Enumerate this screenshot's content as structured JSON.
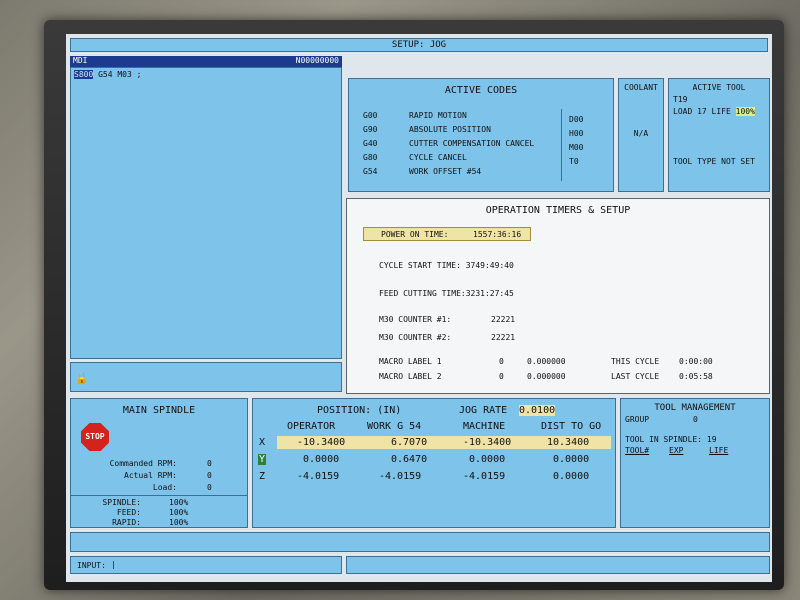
{
  "header": {
    "title": "SETUP: JOG"
  },
  "mdi": {
    "label": "MDI",
    "program_number": "N00000000",
    "cursor_block": "S800",
    "program_rest": " G54 M03 ;"
  },
  "active_codes": {
    "title": "ACTIVE CODES",
    "rows": [
      {
        "code": "G00",
        "desc": "RAPID MOTION"
      },
      {
        "code": "G90",
        "desc": "ABSOLUTE POSITION"
      },
      {
        "code": "G40",
        "desc": "CUTTER COMPENSATION CANCEL"
      },
      {
        "code": "G80",
        "desc": "CYCLE CANCEL"
      },
      {
        "code": "G54",
        "desc": "WORK OFFSET #54"
      }
    ],
    "side": [
      "D00",
      "H00",
      "M00",
      "T0"
    ]
  },
  "coolant": {
    "title": "COOLANT",
    "value": "N/A"
  },
  "active_tool": {
    "title": "ACTIVE TOOL",
    "tool": "T19",
    "load_life_prefix": "LOAD 17 LIFE ",
    "life_value": "100%",
    "tool_type": "TOOL TYPE NOT SET"
  },
  "timers": {
    "title": "OPERATION TIMERS & SETUP",
    "power_on_label": "POWER ON TIME:",
    "power_on_value": "1557:36:16",
    "cycle_start": "CYCLE START TIME: 3749:49:40",
    "feed_cutting": "FEED CUTTING TIME:3231:27:45",
    "m30_1_label": "M30 COUNTER #1:",
    "m30_1_value": "22221",
    "m30_2_label": "M30 COUNTER #2:",
    "m30_2_value": "22221",
    "macro1_label": "MACRO LABEL 1",
    "macro1_num": "0",
    "macro1_val": "0.000000",
    "macro2_label": "MACRO LABEL 2",
    "macro2_num": "0",
    "macro2_val": "0.000000",
    "this_cycle_label": "THIS CYCLE",
    "this_cycle_value": "0:00:00",
    "last_cycle_label": "LAST CYCLE",
    "last_cycle_value": "0:05:58"
  },
  "main_spindle": {
    "title": "MAIN SPINDLE",
    "stop_label": "STOP",
    "commanded_rpm_label": "Commanded RPM:",
    "commanded_rpm": "0",
    "actual_rpm_label": "Actual RPM:",
    "actual_rpm": "0",
    "load_label": "Load:",
    "load": "0",
    "spindle_label": "SPINDLE:",
    "spindle": "100%",
    "feed_label": "FEED:",
    "feed": "100%",
    "rapid_label": "RAPID:",
    "rapid": "100%"
  },
  "position": {
    "title": "POSITION: (IN)",
    "jog_rate_label": "JOG RATE",
    "jog_rate": "0.0100",
    "headers": [
      "OPERATOR",
      "WORK  G 54",
      "MACHINE",
      "DIST TO GO"
    ],
    "rows": [
      {
        "axis": "X",
        "values": [
          "-10.3400",
          "6.7070",
          "-10.3400",
          "10.3400"
        ]
      },
      {
        "axis": "Y",
        "values": [
          "0.0000",
          "0.6470",
          "0.0000",
          "0.0000"
        ]
      },
      {
        "axis": "Z",
        "values": [
          "-4.0159",
          "-4.0159",
          "-4.0159",
          "0.0000"
        ]
      }
    ]
  },
  "tool_management": {
    "title": "TOOL MANAGEMENT",
    "group_label": "GROUP",
    "group_value": "0",
    "tool_in_spindle": "TOOL IN SPINDLE:  19",
    "col_tool": "TOOL#",
    "col_exp": "EXP",
    "col_life": "LIFE"
  },
  "input": {
    "label": "INPUT:"
  },
  "colors": {
    "panel": "#7ec3ea",
    "highlight": "#f0e3a6",
    "stop": "#d3231c"
  }
}
